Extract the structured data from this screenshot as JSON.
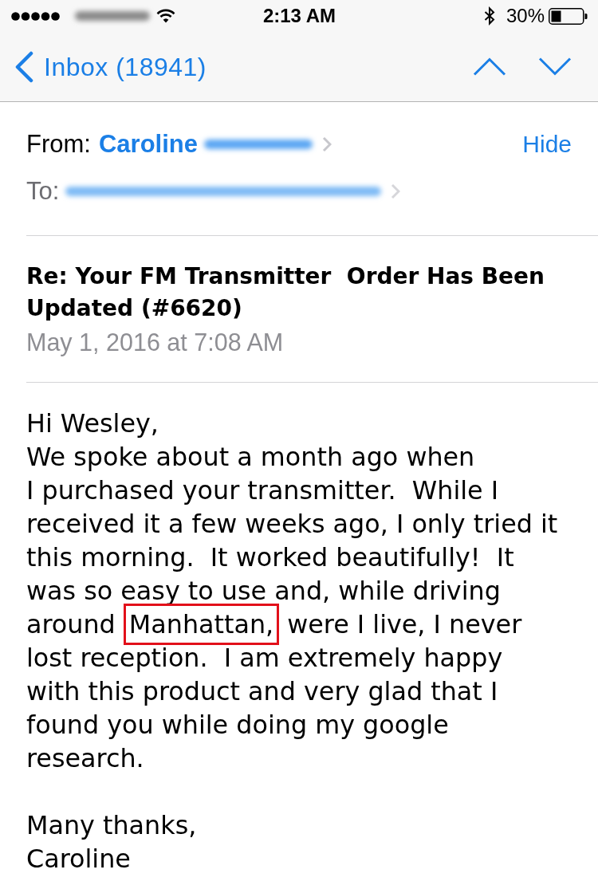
{
  "status_bar": {
    "time": "2:13 AM",
    "battery": "30%"
  },
  "nav_bar": {
    "back": "Inbox (18941)"
  },
  "header": {
    "from_label": "From:",
    "sender": "Caroline",
    "hide": "Hide",
    "to_label": "To:"
  },
  "message": {
    "subject": "Re: Your FM Transmitter  Order Has Been Updated (#6620)",
    "date": "May 1, 2016 at 7:08 AM",
    "body": [
      {
        "lines": [
          [
            {
              "text": "Hi Wesley,",
              "highlighted": false
            }
          ],
          [
            {
              "text": "We spoke about a month ago when",
              "highlighted": false
            }
          ],
          [
            {
              "text": "I purchased your transmitter.  While I",
              "highlighted": false
            }
          ],
          [
            {
              "text": "received it a few weeks ago, I only tried it",
              "highlighted": false
            }
          ],
          [
            {
              "text": "this morning.  It worked beautifully!  It",
              "highlighted": false
            }
          ],
          [
            {
              "text": "was so easy to use and, while driving",
              "highlighted": false
            }
          ],
          [
            {
              "text": "around",
              "highlighted": false
            },
            {
              "text": "Manhattan,",
              "highlighted": true
            },
            {
              "text": "were I live, I never",
              "highlighted": false
            }
          ],
          [
            {
              "text": "lost reception.  I am extremely happy",
              "highlighted": false
            }
          ],
          [
            {
              "text": "with this product and very glad that I",
              "highlighted": false
            }
          ],
          [
            {
              "text": "found you while doing my google",
              "highlighted": false
            }
          ],
          [
            {
              "text": "research.",
              "highlighted": false
            }
          ]
        ]
      },
      {
        "lines": [
          [
            {
              "text": "Many thanks,",
              "highlighted": false
            }
          ],
          [
            {
              "text": "Caroline",
              "highlighted": false
            }
          ]
        ]
      }
    ]
  }
}
